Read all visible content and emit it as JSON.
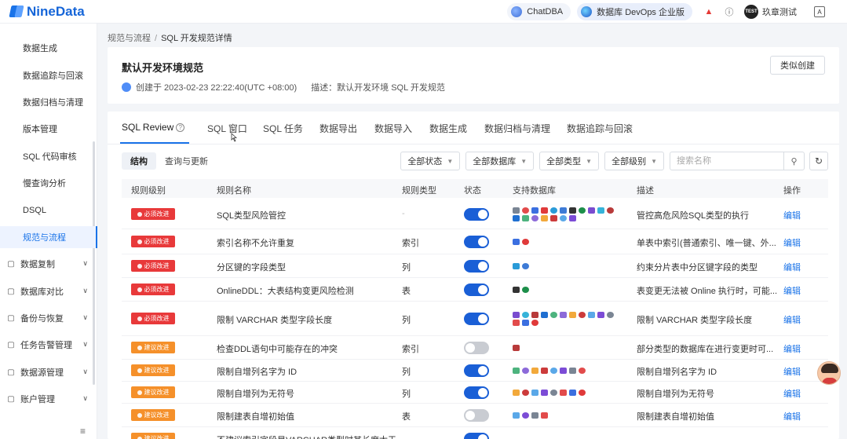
{
  "app": {
    "logo_text": "NineData"
  },
  "topbar": {
    "chatdba_label": "ChatDBA",
    "devops_label": "数据库 DevOps 企业版",
    "avatar_text": "TEST",
    "username": "玖章测试"
  },
  "sidebar": {
    "items": [
      {
        "label": "数据生成",
        "type": "sub"
      },
      {
        "label": "数据追踪与回滚",
        "type": "sub"
      },
      {
        "label": "数据归档与清理",
        "type": "sub"
      },
      {
        "label": "版本管理",
        "type": "sub"
      },
      {
        "label": "SQL 代码审核",
        "type": "sub"
      },
      {
        "label": "慢查询分析",
        "type": "sub"
      },
      {
        "label": "DSQL",
        "type": "sub"
      },
      {
        "label": "规范与流程",
        "type": "sub",
        "active": true
      },
      {
        "label": "数据复制",
        "type": "group",
        "icon": "copy-icon"
      },
      {
        "label": "数据库对比",
        "type": "group",
        "icon": "compare-icon"
      },
      {
        "label": "备份与恢复",
        "type": "group",
        "icon": "backup-icon"
      },
      {
        "label": "任务告警管理",
        "type": "group",
        "icon": "alarm-icon"
      },
      {
        "label": "数据源管理",
        "type": "group",
        "icon": "datasource-icon"
      },
      {
        "label": "账户管理",
        "type": "group",
        "icon": "account-icon"
      }
    ]
  },
  "breadcrumb": {
    "parent": "规范与流程",
    "separator": "/",
    "current": "SQL 开发规范详情"
  },
  "header": {
    "title": "默认开发环境规范",
    "created": "创建于 2023-02-23 22:22:40(UTC +08:00)",
    "description": "描述：默认开发环境 SQL 开发规范",
    "similar_button": "类似创建"
  },
  "tabs": [
    "SQL Review",
    "SQL 窗口",
    "SQL 任务",
    "数据导出",
    "数据导入",
    "数据生成",
    "数据归档与清理",
    "数据追踪与回滚"
  ],
  "subtabs": [
    "结构",
    "查询与更新"
  ],
  "filters": {
    "status": "全部状态",
    "database": "全部数据库",
    "type": "全部类型",
    "level": "全部级别",
    "search_placeholder": "搜索名称"
  },
  "table": {
    "headers": [
      "规则级别",
      "规则名称",
      "规则类型",
      "状态",
      "支持数据库",
      "描述",
      "操作"
    ],
    "rows": [
      {
        "level": "必须改进",
        "level_color": "red",
        "name": "SQL类型风险管控",
        "type": "-",
        "enabled": true,
        "db_count": 18,
        "desc": "管控高危风险SQL类型的执行",
        "op": "编辑"
      },
      {
        "level": "必须改进",
        "level_color": "red",
        "name": "索引名称不允许重复",
        "type": "索引",
        "enabled": true,
        "db_count": 2,
        "desc": "单表中索引(普通索引、唯一键、外...",
        "op": "编辑"
      },
      {
        "level": "必须改进",
        "level_color": "red",
        "name": "分区键的字段类型",
        "type": "列",
        "enabled": true,
        "db_count": 2,
        "desc": "约束分片表中分区键字段的类型",
        "op": "编辑"
      },
      {
        "level": "必须改进",
        "level_color": "red",
        "name": "OnlineDDL：大表结构变更风险检测",
        "type": "表",
        "enabled": true,
        "db_count": 2,
        "desc": "表变更无法被 Online 执行时，可能...",
        "op": "编辑"
      },
      {
        "level": "必须改进",
        "level_color": "red",
        "name": "限制 VARCHAR 类型字段长度",
        "type": "列",
        "enabled": true,
        "db_count": 14,
        "desc": "限制 VARCHAR 类型字段长度",
        "op": "编辑"
      },
      {
        "level": "建议改进",
        "level_color": "orange",
        "name": "检查DDL语句中可能存在的冲突",
        "type": "索引",
        "enabled": false,
        "db_count": 1,
        "desc": "部分类型的数据库在进行变更时可...",
        "op": "编辑"
      },
      {
        "level": "建议改进",
        "level_color": "orange",
        "name": "限制自增列名字为 ID",
        "type": "列",
        "enabled": true,
        "db_count": 8,
        "desc": "限制自增列名字为 ID",
        "op": "编辑"
      },
      {
        "level": "建议改进",
        "level_color": "orange",
        "name": "限制自增列为无符号",
        "type": "列",
        "enabled": true,
        "db_count": 8,
        "desc": "限制自增列为无符号",
        "op": "编辑"
      },
      {
        "level": "建议改进",
        "level_color": "orange",
        "name": "限制建表自增初始值",
        "type": "表",
        "enabled": false,
        "db_count": 4,
        "desc": "限制建表自增初始值",
        "op": "编辑"
      },
      {
        "level": "建议改进",
        "level_color": "orange",
        "name": "不建议索引字段是VARCHAR类型时其长度太于",
        "type": "",
        "enabled": true,
        "db_count": 0,
        "desc": "",
        "op": ""
      }
    ]
  },
  "colors": {
    "accent": "#1a73e8",
    "danger": "#e8393a",
    "warning": "#f5902a"
  }
}
